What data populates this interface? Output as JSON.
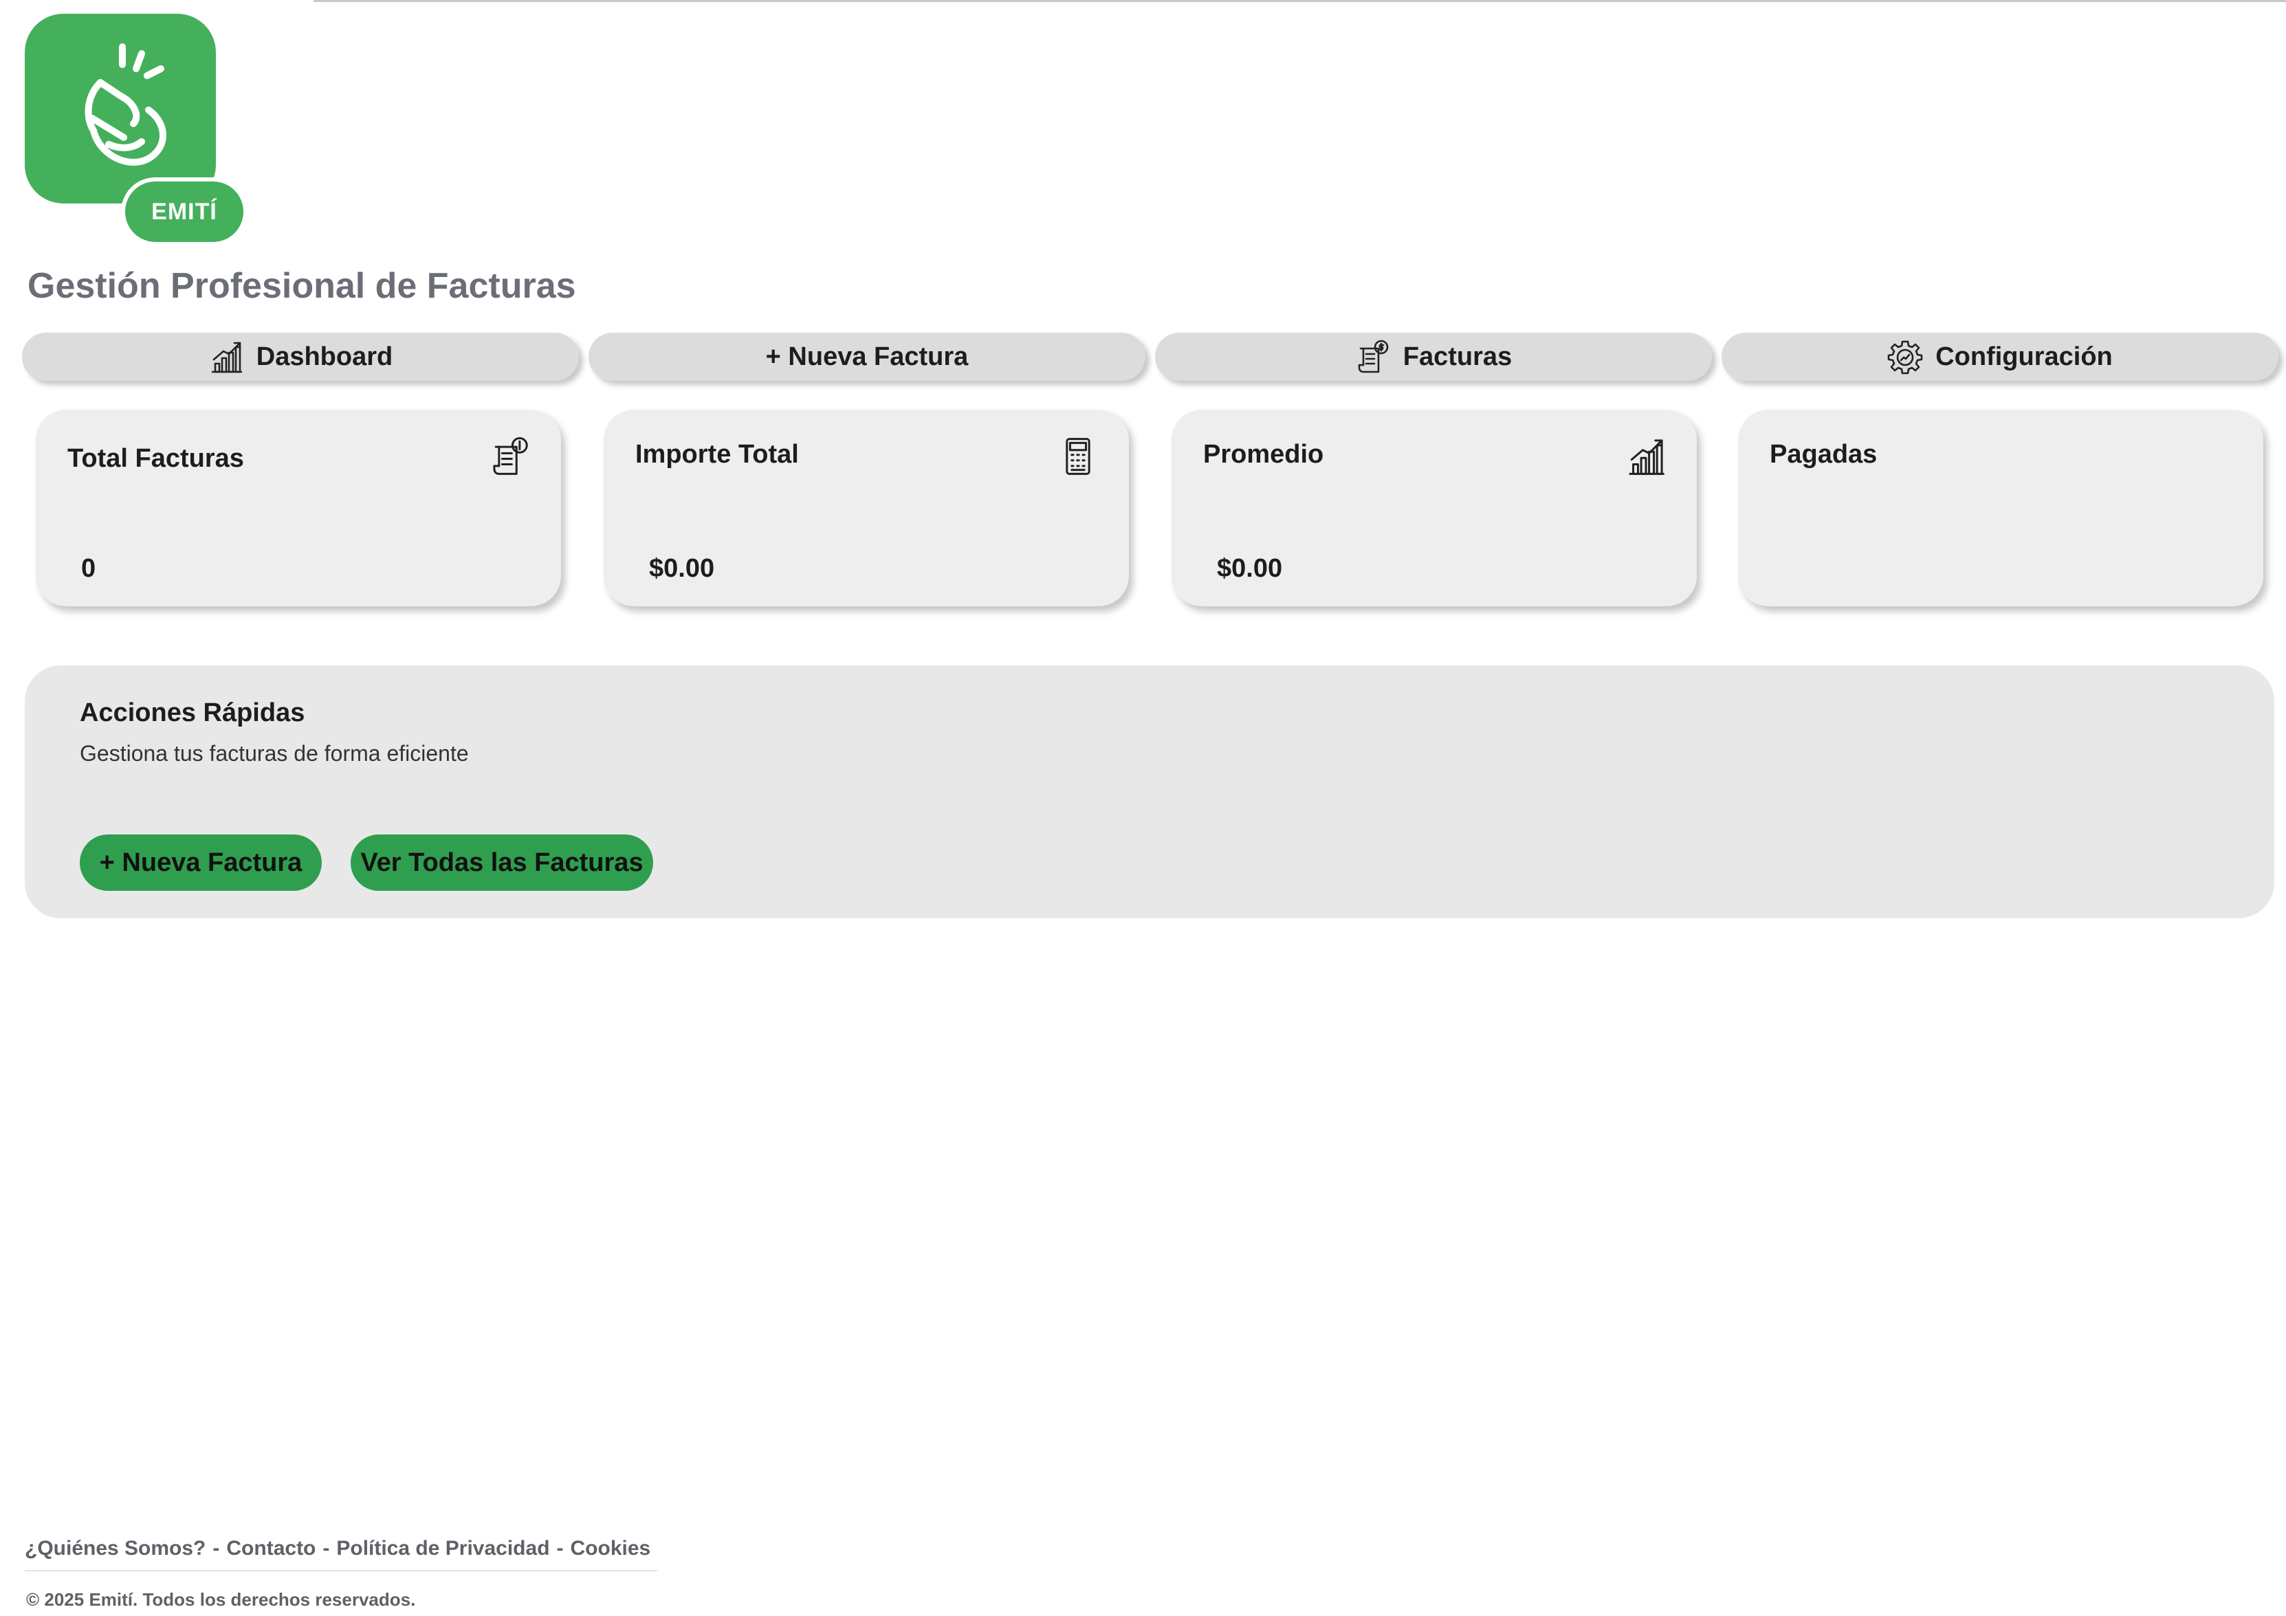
{
  "brand": {
    "name": "EMITÍ",
    "subtitle": "Gestión Profesional de Facturas",
    "color": "#45b05b"
  },
  "nav": {
    "items": [
      {
        "label": "Dashboard",
        "icon": "chart-bar-icon"
      },
      {
        "label": "+ Nueva Factura",
        "icon": ""
      },
      {
        "label": "Facturas",
        "icon": "invoice-icon"
      },
      {
        "label": "Configuración",
        "icon": "gear-icon"
      }
    ]
  },
  "stats": [
    {
      "title": "Total Facturas",
      "value": "0",
      "icon": "invoice-icon"
    },
    {
      "title": "Importe Total",
      "value": "$0.00",
      "icon": "calculator-icon"
    },
    {
      "title": "Promedio",
      "value": "$0.00",
      "icon": "chart-growth-icon"
    },
    {
      "title": "Pagadas",
      "value": "",
      "icon": ""
    }
  ],
  "quick_actions": {
    "title": "Acciones Rápidas",
    "description": "Gestiona tus facturas de forma eficiente",
    "buttons": [
      {
        "label": "+ Nueva Factura"
      },
      {
        "label": "Ver Todas las Facturas"
      }
    ],
    "button_color": "#2f9e4f"
  },
  "footer": {
    "links": [
      "¿Quiénes Somos?",
      "Contacto",
      "Política de Privacidad",
      "Cookies"
    ],
    "separator": "-",
    "copyright": "© 2025 Emití. Todos los derechos reservados."
  }
}
